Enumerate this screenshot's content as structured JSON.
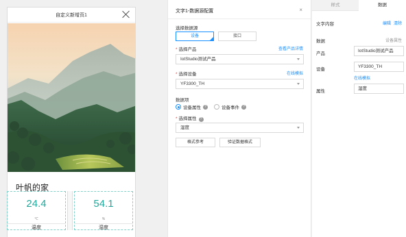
{
  "preview": {
    "title": "自定义新增页1",
    "home_title": "叶帆的家",
    "metrics": [
      {
        "value": "24.4",
        "sub": "℃",
        "label": "温度"
      },
      {
        "value": "54.1",
        "sub": "%",
        "label": "湿度"
      }
    ]
  },
  "config": {
    "title": "文字1-数据源配置",
    "close": "×",
    "source_label": "选择数据源",
    "source_options": [
      "设备",
      "接口"
    ],
    "product_label": "选择产品",
    "product_link": "查看产品详情",
    "product_value": "IotStudio测试产品",
    "device_label": "选择设备",
    "device_link": "在线模拟",
    "device_value": "YF3300_TH",
    "data_item_label": "数据项",
    "radio_property": "设备属性",
    "radio_event": "设备事件",
    "attr_label": "选择属性",
    "attr_value": "湿度",
    "btn_format": "格式参考",
    "btn_verify": "验证数据格式"
  },
  "props": {
    "tab_style": "样式",
    "tab_data": "数据",
    "text_content_label": "文字内容",
    "edit_link": "编辑",
    "clear_link": "清除",
    "data_label": "数据",
    "device_attr_label": "设备属性",
    "product_label": "产品",
    "product_value": "IotStudio测试产品",
    "device_label": "设备",
    "device_value": "YF3300_TH",
    "simulate_link": "在线模拟",
    "attr_label": "属性",
    "attr_value": "湿度"
  },
  "colors": {
    "accent": "#1890ff",
    "metric": "#26a69a"
  }
}
